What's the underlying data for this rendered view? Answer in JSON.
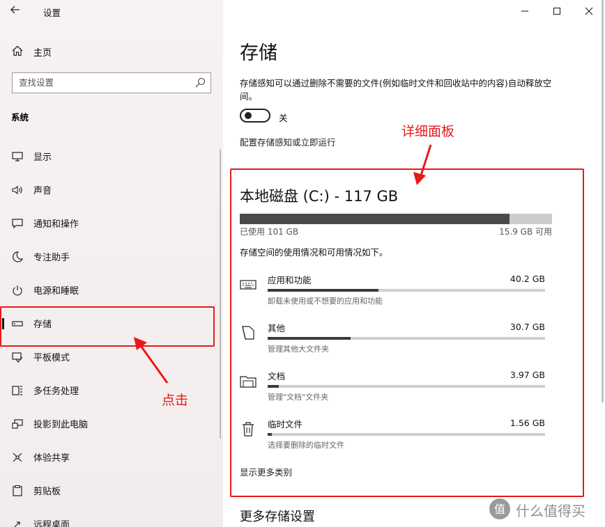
{
  "window": {
    "title": "设置",
    "controls": [
      "minimize-icon",
      "maximize-icon",
      "close-icon"
    ]
  },
  "sidebar": {
    "home_label": "主页",
    "search_placeholder": "查找设置",
    "section_title": "系统",
    "items": [
      {
        "label": "显示",
        "icon": "display-icon"
      },
      {
        "label": "声音",
        "icon": "speaker-icon"
      },
      {
        "label": "通知和操作",
        "icon": "notification-icon"
      },
      {
        "label": "专注助手",
        "icon": "moon-icon"
      },
      {
        "label": "电源和睡眠",
        "icon": "power-icon"
      },
      {
        "label": "存储",
        "icon": "storage-icon",
        "selected": true
      },
      {
        "label": "平板模式",
        "icon": "tablet-icon"
      },
      {
        "label": "多任务处理",
        "icon": "multitask-icon"
      },
      {
        "label": "投影到此电脑",
        "icon": "project-icon"
      },
      {
        "label": "体验共享",
        "icon": "share-icon"
      },
      {
        "label": "剪贴板",
        "icon": "clipboard-icon"
      },
      {
        "label": "远程桌面",
        "icon": "remote-desktop-icon"
      }
    ]
  },
  "main": {
    "title": "存储",
    "description": "存储感知可以通过删除不需要的文件(例如临时文件和回收站中的内容)自动释放空间。",
    "toggle": {
      "state": "off",
      "label": "关"
    },
    "configure_link": "配置存储感知或立即运行",
    "drive": {
      "title": "本地磁盘 (C:) - 117 GB",
      "used_label": "已使用 101 GB",
      "free_label": "15.9 GB 可用",
      "used_fraction": 0.864
    },
    "usage_hint": "存储空间的使用情况和可用情况如下。",
    "categories": [
      {
        "name": "应用和功能",
        "size": "40.2 GB",
        "desc": "卸载未使用或不想要的应用和功能",
        "fraction": 0.4,
        "icon": "keyboard-icon"
      },
      {
        "name": "其他",
        "size": "30.7 GB",
        "desc": "管理其他大文件夹",
        "fraction": 0.3,
        "icon": "other-files-icon"
      },
      {
        "name": "文档",
        "size": "3.97 GB",
        "desc": "管理\"文档\"文件夹",
        "fraction": 0.04,
        "icon": "folder-icon"
      },
      {
        "name": "临时文件",
        "size": "1.56 GB",
        "desc": "选择要删除的临时文件",
        "fraction": 0.015,
        "icon": "trash-icon"
      }
    ],
    "show_more": "显示更多类别",
    "more_settings": "更多存储设置"
  },
  "annotations": {
    "detail_label": "详细面板",
    "click_label": "点击",
    "color": "#e81919"
  },
  "watermark": {
    "text": "什么值得买"
  }
}
